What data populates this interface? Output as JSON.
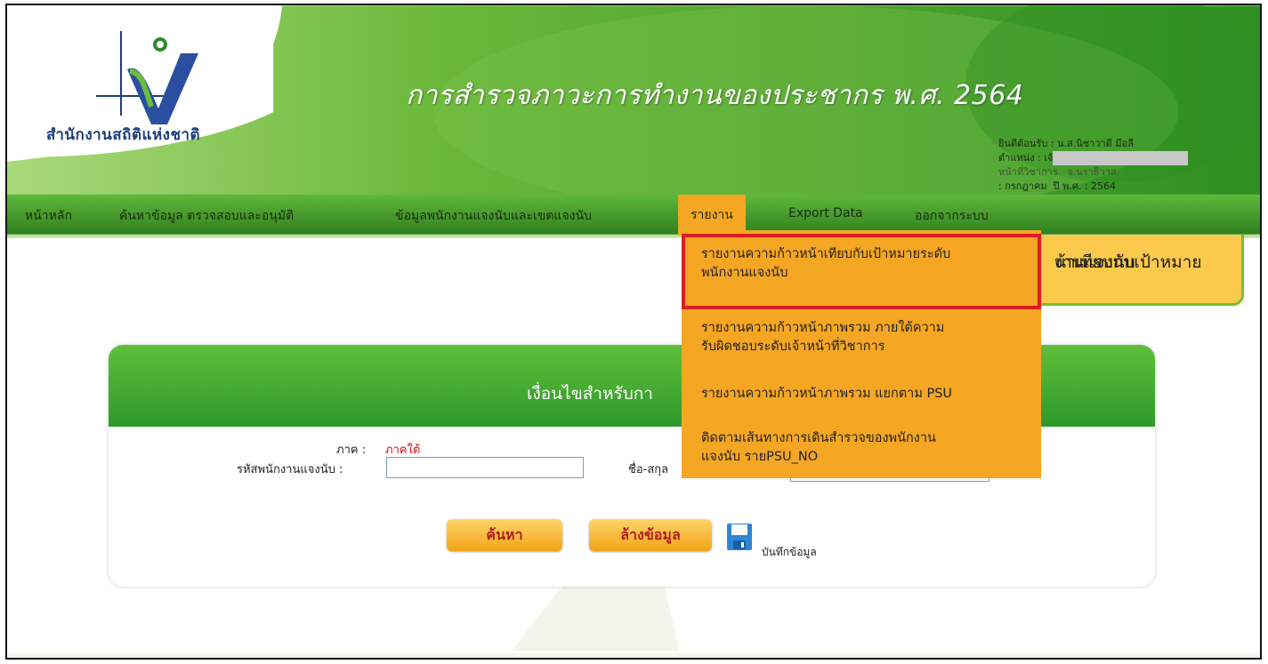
{
  "header": {
    "logo_text": "สำนักงานสถิติแห่งชาติ",
    "site_title": "การสำรวจภาวะการทำงานของประชากร พ.ศ. 2564",
    "user": {
      "welcome": "ยินดีต้อนรับ : น.ส.นิชาวาดี มีอลี",
      "position_label": "ตำแหน่ง : เจ้",
      "role": "หน้าที่วิชาการ",
      "province": "จ.นราธิวาส",
      "month": ": กรกฎาคม",
      "year": "ปี พ.ศ. : 2564"
    }
  },
  "nav": {
    "items": [
      "หน้าหลัก",
      "ค้นหาข้อมูล ตรวจสอบและอนุมัติ",
      "ข้อมูลพนักงานแจงนับและเขตแจงนับ",
      "รายงาน",
      "Export Data",
      "ออกจากระบบ"
    ],
    "active_index": 3
  },
  "side_banner": {
    "line1": "น้าเทียบกับเป้าหมาย",
    "line2": "งานแจงนับ"
  },
  "dropdown": {
    "items": [
      {
        "line1": "รายงานความก้าวหน้าเทียบกับเป้าหมายระดับ",
        "line2": "พนักงานแจงนับ",
        "highlighted": true
      },
      {
        "line1": "รายงานความก้าวหน้าภาพรวม ภายใต้ความ",
        "line2": "รับผิดชอบระดับเจ้าหน้าที่วิชาการ",
        "highlighted": false
      },
      {
        "line1": "รายงานความก้าวหน้าภาพรวม แยกตาม PSU",
        "line2": "",
        "highlighted": false
      },
      {
        "line1": "ติดตามเส้นทางการเดินสำรวจของพนักงาน",
        "line2": "แจงนับ รายPSU_NO",
        "highlighted": false
      }
    ]
  },
  "search_panel": {
    "title": "เงื่อนไขสำหรับกา",
    "region_label": "ภาค :",
    "region_value": "ภาคใต้",
    "emp_id_label": "รหัสพนักงานแจงนับ :",
    "emp_id_value": "",
    "name_label": "ชื่อ-สกุล",
    "name_value": "",
    "search_button": "ค้นหา",
    "clear_button": "ล้างข้อมูล",
    "save_label": "บันทึกข้อมูล"
  },
  "colors": {
    "nav_green": "#3f9a2c",
    "menu_orange": "#f5a623",
    "highlight_red": "#e01b24",
    "panel_green": "#4fb034"
  }
}
